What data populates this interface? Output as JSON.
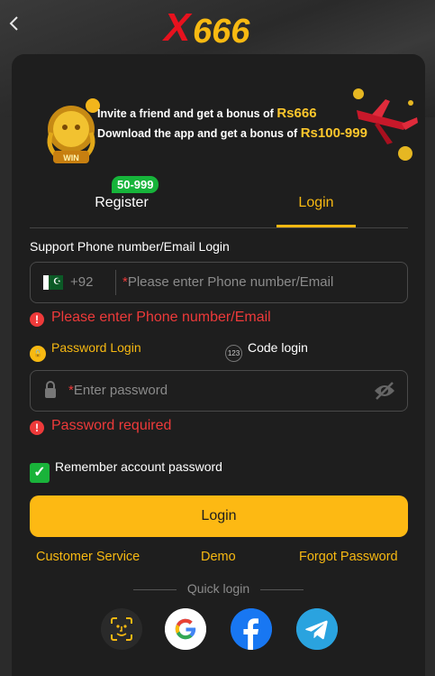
{
  "header": {
    "logo_x": "X",
    "logo_num": "666"
  },
  "banner": {
    "line1_text": "Invite a friend and get a bonus of ",
    "line1_amount": "Rs666",
    "line2_text": "Download the app and get a bonus of ",
    "line2_amount": "Rs100-999",
    "badge_text": "WIN"
  },
  "tabs": {
    "register_label": "Register",
    "register_badge": "50-999",
    "login_label": "Login"
  },
  "form": {
    "section_title": "Support Phone number/Email Login",
    "phone_prefix": "+92",
    "phone_required_mark": "*",
    "phone_placeholder": "Please enter Phone number/Email",
    "phone_error": "Please enter Phone number/Email",
    "password_mode_label": "Password Login",
    "code_mode_label": "Code login",
    "code_mode_icon_text": "123",
    "password_required_mark": "*",
    "password_placeholder": "Enter password",
    "password_error": "Password required",
    "remember_label": "Remember account password",
    "login_button": "Login"
  },
  "links": {
    "customer_service": "Customer Service",
    "demo": "Demo",
    "forgot_password": "Forgot Password"
  },
  "quick_login": {
    "label": "Quick login",
    "providers": [
      "face-id-icon",
      "google-icon",
      "facebook-icon",
      "telegram-icon"
    ]
  },
  "colors": {
    "accent": "#f7b912",
    "error": "#ee3a3a",
    "success": "#19b33a",
    "card_bg": "#1e1e1e"
  }
}
